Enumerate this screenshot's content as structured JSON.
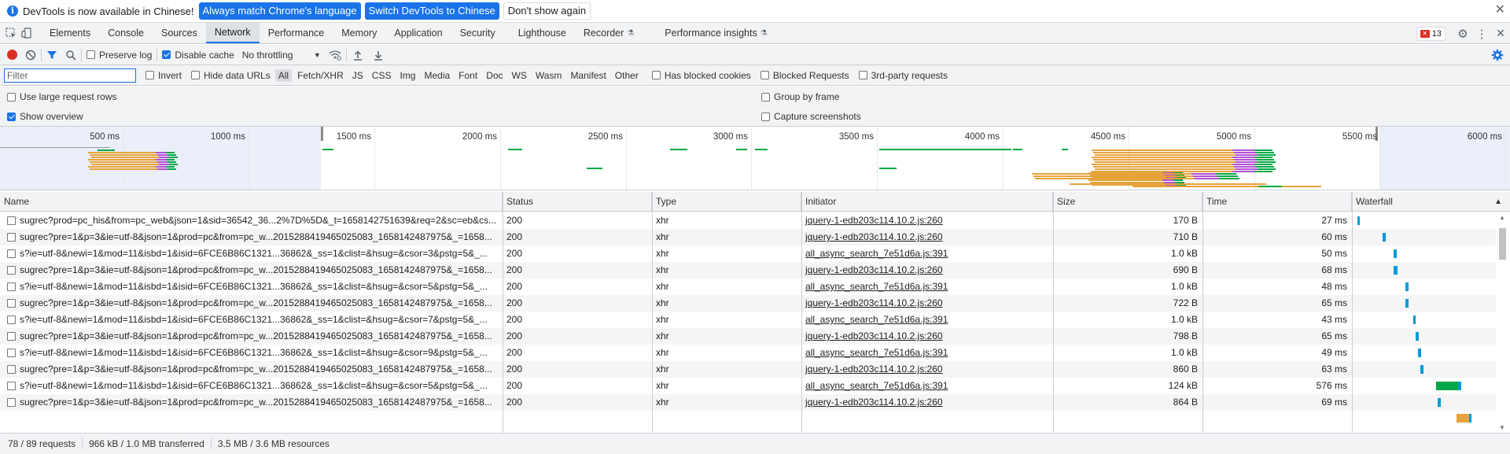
{
  "infobar": {
    "message": "DevTools is now available in Chinese!",
    "btn_match": "Always match Chrome's language",
    "btn_switch": "Switch DevTools to Chinese",
    "btn_dont_show": "Don't show again",
    "close": "✕"
  },
  "tabs": [
    {
      "label": "Elements"
    },
    {
      "label": "Console"
    },
    {
      "label": "Sources"
    },
    {
      "label": "Network",
      "active": true
    },
    {
      "label": "Performance"
    },
    {
      "label": "Memory"
    },
    {
      "label": "Application"
    },
    {
      "label": "Security"
    },
    {
      "label": "Lighthouse"
    },
    {
      "label": "Recorder",
      "experimental": true
    },
    {
      "label": "Performance insights",
      "experimental": true
    }
  ],
  "issues_count": "13",
  "toolbar": {
    "preserve_log": "Preserve log",
    "preserve_log_checked": false,
    "disable_cache": "Disable cache",
    "disable_cache_checked": true,
    "throttling": "No throttling"
  },
  "filterbar": {
    "placeholder": "Filter",
    "invert": "Invert",
    "hide_data_urls": "Hide data URLs",
    "types": [
      "All",
      "Fetch/XHR",
      "JS",
      "CSS",
      "Img",
      "Media",
      "Font",
      "Doc",
      "WS",
      "Wasm",
      "Manifest",
      "Other"
    ],
    "active_type": "All",
    "has_blocked_cookies": "Has blocked cookies",
    "blocked_requests": "Blocked Requests",
    "third_party": "3rd-party requests"
  },
  "settings": {
    "large_rows": "Use large request rows",
    "large_rows_checked": false,
    "show_overview": "Show overview",
    "show_overview_checked": true,
    "group_by_frame": "Group by frame",
    "group_by_frame_checked": false,
    "capture_screenshots": "Capture screenshots",
    "capture_screenshots_checked": false
  },
  "overview": {
    "ticks": [
      "500 ms",
      "1000 ms",
      "1500 ms",
      "2000 ms",
      "2500 ms",
      "3000 ms",
      "3500 ms",
      "4000 ms",
      "4500 ms",
      "5000 ms",
      "5500 ms",
      "6000 ms"
    ]
  },
  "columns": {
    "name": "Name",
    "status": "Status",
    "type": "Type",
    "initiator": "Initiator",
    "size": "Size",
    "time": "Time",
    "waterfall": "Waterfall"
  },
  "rows": [
    {
      "name": "sugrec?prod=pc_his&from=pc_web&json=1&sid=36542_36...2%7D%5D&_t=1658142751639&req=2&sc=eb&cs...",
      "status": "200",
      "type": "xhr",
      "initiator": "jquery-1-edb203c114.10.2.js:260",
      "size": "170 B",
      "time": "27 ms"
    },
    {
      "name": "sugrec?pre=1&p=3&ie=utf-8&json=1&prod=pc&from=pc_w...2015288419465025083_1658142487975&_=1658...",
      "status": "200",
      "type": "xhr",
      "initiator": "jquery-1-edb203c114.10.2.js:260",
      "size": "710 B",
      "time": "60 ms"
    },
    {
      "name": "s?ie=utf-8&newi=1&mod=11&isbd=1&isid=6FCE6B86C1321...36862&_ss=1&clist=&hsug=&csor=3&pstg=5&_...",
      "status": "200",
      "type": "xhr",
      "initiator": "all_async_search_7e51d6a.js:391",
      "size": "1.0 kB",
      "time": "50 ms"
    },
    {
      "name": "sugrec?pre=1&p=3&ie=utf-8&json=1&prod=pc&from=pc_w...2015288419465025083_1658142487975&_=1658...",
      "status": "200",
      "type": "xhr",
      "initiator": "jquery-1-edb203c114.10.2.js:260",
      "size": "690 B",
      "time": "68 ms"
    },
    {
      "name": "s?ie=utf-8&newi=1&mod=11&isbd=1&isid=6FCE6B86C1321...36862&_ss=1&clist=&hsug=&csor=5&pstg=5&_...",
      "status": "200",
      "type": "xhr",
      "initiator": "all_async_search_7e51d6a.js:391",
      "size": "1.0 kB",
      "time": "48 ms"
    },
    {
      "name": "sugrec?pre=1&p=3&ie=utf-8&json=1&prod=pc&from=pc_w...2015288419465025083_1658142487975&_=1658...",
      "status": "200",
      "type": "xhr",
      "initiator": "jquery-1-edb203c114.10.2.js:260",
      "size": "722 B",
      "time": "65 ms"
    },
    {
      "name": "s?ie=utf-8&newi=1&mod=11&isbd=1&isid=6FCE6B86C1321...36862&_ss=1&clist=&hsug=&csor=7&pstg=5&_...",
      "status": "200",
      "type": "xhr",
      "initiator": "all_async_search_7e51d6a.js:391",
      "size": "1.0 kB",
      "time": "43 ms"
    },
    {
      "name": "sugrec?pre=1&p=3&ie=utf-8&json=1&prod=pc&from=pc_w...2015288419465025083_1658142487975&_=1658...",
      "status": "200",
      "type": "xhr",
      "initiator": "jquery-1-edb203c114.10.2.js:260",
      "size": "798 B",
      "time": "65 ms"
    },
    {
      "name": "s?ie=utf-8&newi=1&mod=11&isbd=1&isid=6FCE6B86C1321...36862&_ss=1&clist=&hsug=&csor=9&pstg=5&_...",
      "status": "200",
      "type": "xhr",
      "initiator": "all_async_search_7e51d6a.js:391",
      "size": "1.0 kB",
      "time": "49 ms"
    },
    {
      "name": "sugrec?pre=1&p=3&ie=utf-8&json=1&prod=pc&from=pc_w...2015288419465025083_1658142487975&_=1658...",
      "status": "200",
      "type": "xhr",
      "initiator": "jquery-1-edb203c114.10.2.js:260",
      "size": "860 B",
      "time": "63 ms"
    },
    {
      "name": "s?ie=utf-8&newi=1&mod=11&isbd=1&isid=6FCE6B86C1321...36862&_ss=1&clist=&hsug=&csor=5&pstg=5&_...",
      "status": "200",
      "type": "xhr",
      "initiator": "all_async_search_7e51d6a.js:391",
      "size": "124 kB",
      "time": "576 ms"
    },
    {
      "name": "sugrec?pre=1&p=3&ie=utf-8&json=1&prod=pc&from=pc_w...2015288419465025083_1658142487975&_=1658...",
      "status": "200",
      "type": "xhr",
      "initiator": "jquery-1-edb203c114.10.2.js:260",
      "size": "864 B",
      "time": "69 ms"
    }
  ],
  "status": {
    "requests": "78 / 89 requests",
    "transferred": "966 kB / 1.0 MB transferred",
    "resources": "3.5 MB / 3.6 MB resources"
  },
  "colors": {
    "accent": "#1a73e8",
    "waiting": "#00a846",
    "download": "#0299d8",
    "bar_orange": "#e8a33a",
    "bar_purple": "#b14fd6"
  }
}
